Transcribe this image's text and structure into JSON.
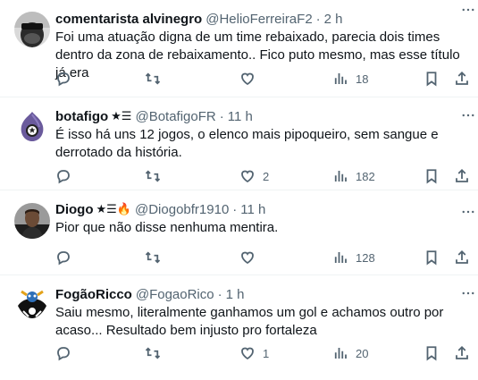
{
  "tweets": [
    {
      "name": "comentarista alvinegro",
      "badges": "",
      "handle": "@HelioFerreiraF2",
      "dot": "·",
      "time": "2 h",
      "text": "Foi uma atuação digna de um time rebaixado, parecia dois times dentro da zona de rebaixamento.. Fico puto mesmo, mas esse título já era",
      "replies": "",
      "retweets": "",
      "likes": "",
      "views": "18"
    },
    {
      "name": "botafigo",
      "badges": "★☰",
      "handle": "@BotafigoFR",
      "dot": "·",
      "time": "11 h",
      "text": "É isso há uns 12 jogos, o elenco mais pipoqueiro, sem sangue e derrotado da história.",
      "replies": "",
      "retweets": "",
      "likes": "2",
      "views": "182"
    },
    {
      "name": "Diogo",
      "badges": "★☰🔥",
      "handle": "@Diogobfr1910",
      "dot": "·",
      "time": "11 h",
      "text": "Pior que não disse nenhuma mentira.",
      "replies": "",
      "retweets": "",
      "likes": "",
      "views": "128"
    },
    {
      "name": "FogãoRicco",
      "badges": "",
      "handle": "@FogaoRico",
      "dot": "·",
      "time": "1 h",
      "text": "Saiu mesmo, literalmente ganhamos um gol e achamos outro por acaso... Resultado bem injusto pro fortaleza",
      "replies": "",
      "retweets": "",
      "likes": "1",
      "views": "20"
    }
  ],
  "icons": {
    "more": "more-horizontal-icon",
    "reply": "reply-icon",
    "retweet": "retweet-icon",
    "like": "heart-icon",
    "views": "views-bar-chart-icon",
    "bookmark": "bookmark-icon",
    "share": "share-upload-icon"
  },
  "colors": {
    "text": "#0f1419",
    "secondary": "#536471",
    "divider": "#eff3f4"
  }
}
